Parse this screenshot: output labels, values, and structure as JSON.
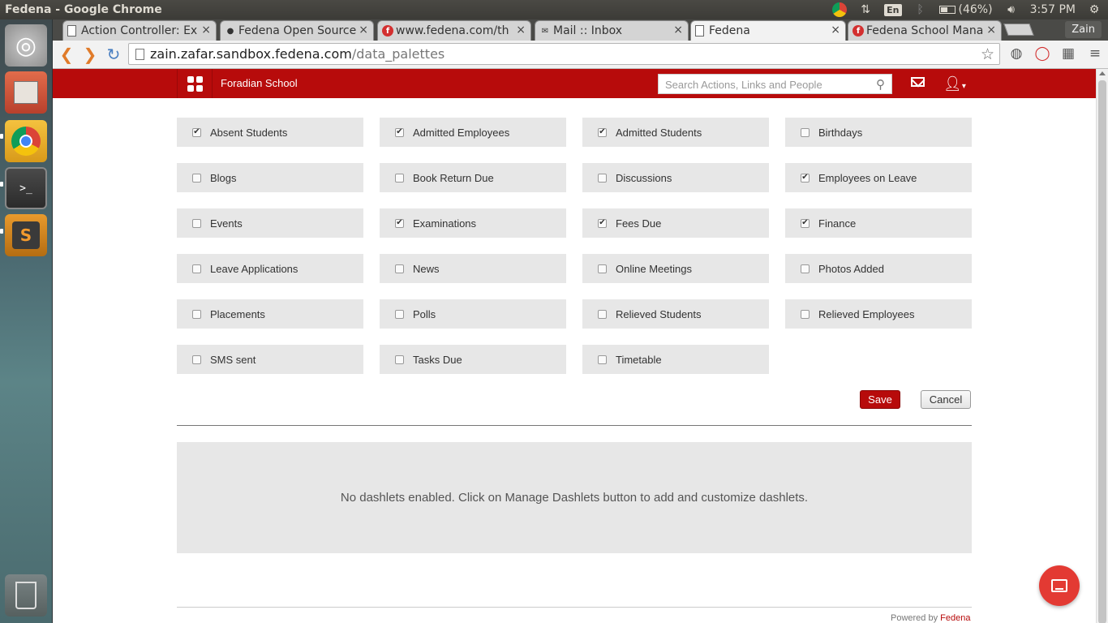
{
  "os_panel": {
    "window_title": "Fedena - Google Chrome",
    "keyboard": "En",
    "battery": "(46%)",
    "clock": "3:57 PM"
  },
  "browser": {
    "tabs": [
      {
        "label": "Action Controller: Ex",
        "icon": "document-icon"
      },
      {
        "label": "Fedena Open Source",
        "icon": "github-icon"
      },
      {
        "label": "www.fedena.com/th",
        "icon": "fedena-icon"
      },
      {
        "label": "Mail :: Inbox",
        "icon": "mail-icon"
      },
      {
        "label": "Fedena",
        "icon": "document-icon",
        "active": true
      },
      {
        "label": "Fedena School Mana",
        "icon": "fedena-icon"
      }
    ],
    "profile": "Zain",
    "url_host": "zain.zafar.sandbox.fedena.com",
    "url_path": "/data_palettes"
  },
  "header": {
    "school_name": "Foradian School",
    "search_placeholder": "Search Actions, Links and People"
  },
  "palettes": [
    {
      "label": "Absent Students",
      "checked": true
    },
    {
      "label": "Admitted Employees",
      "checked": true
    },
    {
      "label": "Admitted Students",
      "checked": true
    },
    {
      "label": "Birthdays",
      "checked": false
    },
    {
      "label": "Blogs",
      "checked": false
    },
    {
      "label": "Book Return Due",
      "checked": false
    },
    {
      "label": "Discussions",
      "checked": false
    },
    {
      "label": "Employees on Leave",
      "checked": true
    },
    {
      "label": "Events",
      "checked": false
    },
    {
      "label": "Examinations",
      "checked": true
    },
    {
      "label": "Fees Due",
      "checked": true
    },
    {
      "label": "Finance",
      "checked": true
    },
    {
      "label": "Leave Applications",
      "checked": false
    },
    {
      "label": "News",
      "checked": false
    },
    {
      "label": "Online Meetings",
      "checked": false
    },
    {
      "label": "Photos Added",
      "checked": false
    },
    {
      "label": "Placements",
      "checked": false
    },
    {
      "label": "Polls",
      "checked": false
    },
    {
      "label": "Relieved Students",
      "checked": false
    },
    {
      "label": "Relieved Employees",
      "checked": false
    },
    {
      "label": "SMS sent",
      "checked": false
    },
    {
      "label": "Tasks Due",
      "checked": false
    },
    {
      "label": "Timetable",
      "checked": false
    }
  ],
  "actions": {
    "save_label": "Save",
    "cancel_label": "Cancel"
  },
  "dashlets": {
    "empty_message": "No dashlets enabled. Click on Manage Dashlets button to add and customize dashlets."
  },
  "footer": {
    "powered_by": "Powered by",
    "brand": "Fedena"
  },
  "colors": {
    "brand_red": "#b70b0b",
    "palette_bg": "#e7e7e7",
    "fab_red": "#e33a33"
  }
}
